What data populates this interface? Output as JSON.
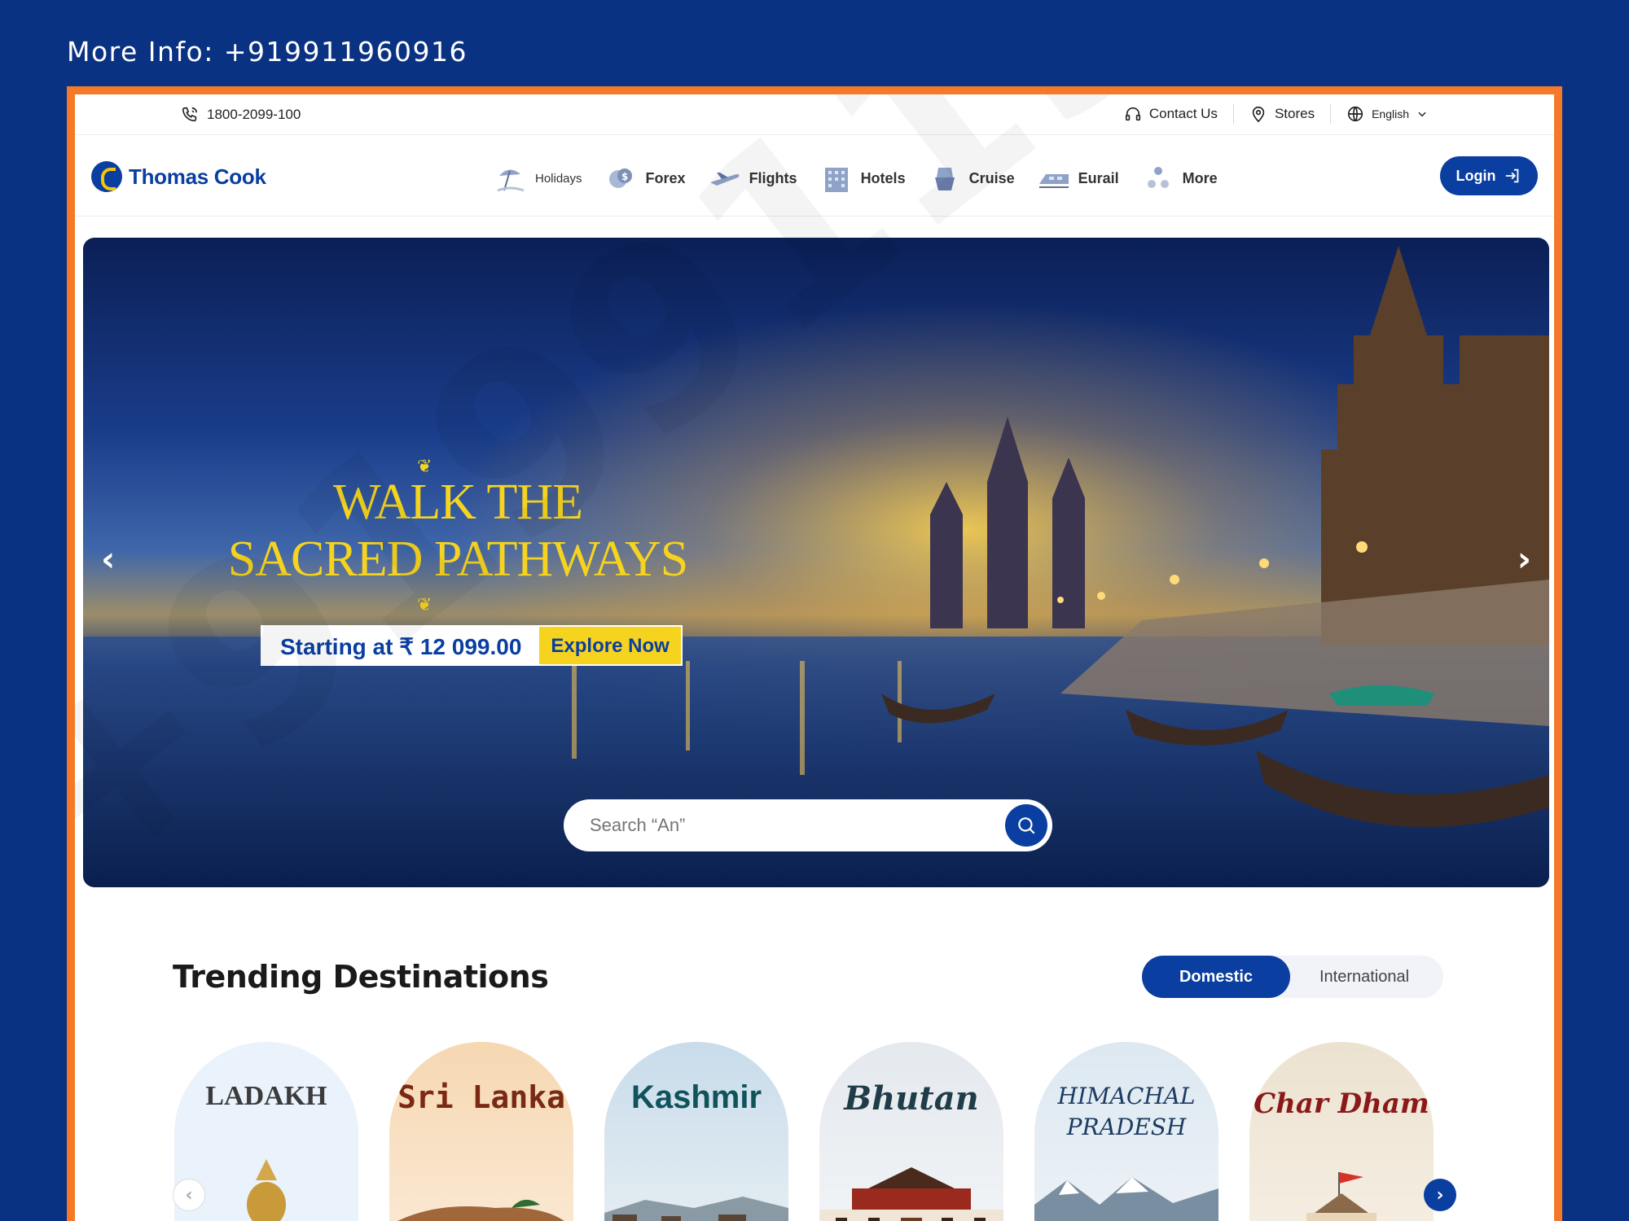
{
  "promo": {
    "text": "More Info: +919911960916"
  },
  "watermark": {
    "text": "+919911960916"
  },
  "utility": {
    "phone": "1800-2099-100",
    "links": [
      {
        "label": "Contact Us",
        "icon": "headset-icon"
      },
      {
        "label": "Stores",
        "icon": "location-pin-icon"
      },
      {
        "label": "English",
        "icon": "globe-icon"
      }
    ]
  },
  "header": {
    "brand": "Thomas Cook",
    "nav": [
      {
        "label": "Holidays",
        "icon": "beach-umbrella-icon"
      },
      {
        "label": "Forex",
        "icon": "currency-coins-icon"
      },
      {
        "label": "Flights",
        "icon": "airplane-icon"
      },
      {
        "label": "Hotels",
        "icon": "hotel-building-icon"
      },
      {
        "label": "Cruise",
        "icon": "cruise-ship-icon"
      },
      {
        "label": "Eurail",
        "icon": "train-icon"
      },
      {
        "label": "More",
        "icon": "more-dots-icon"
      }
    ],
    "login_label": "Login"
  },
  "hero": {
    "title_line1": "WALK THE",
    "title_line2": "SACRED PATHWAYS",
    "price_text": "Starting at ₹ 12 099.00",
    "cta_label": "Explore Now",
    "search_placeholder": "Search “An”"
  },
  "trending": {
    "title": "Trending Destinations",
    "tabs": [
      {
        "label": "Domestic",
        "active": true
      },
      {
        "label": "International",
        "active": false
      }
    ],
    "cards": [
      {
        "label": "LADAKH",
        "color": "#3b3b3b",
        "bg": "#eaf2fb"
      },
      {
        "label": "Sri Lanka",
        "color": "#7a2a14",
        "bg": "#f6d8b2"
      },
      {
        "label": "Kashmir",
        "color": "#10535a",
        "bg": "#c8dceb"
      },
      {
        "label": "Bhutan",
        "color": "#1f3c48",
        "bg": "#e4e9ee"
      },
      {
        "label": "HIMACHAL PRADESH",
        "color": "#1c3c63",
        "bg": "#dde8f1"
      },
      {
        "label": "Char Dham",
        "color": "#8a1a1a",
        "bg": "#ece2d0"
      }
    ]
  },
  "colors": {
    "brand_blue": "#0a3ea0",
    "accent_orange": "#f47a2a",
    "hero_gold": "#f5d31f",
    "page_bg": "#0a3282"
  }
}
